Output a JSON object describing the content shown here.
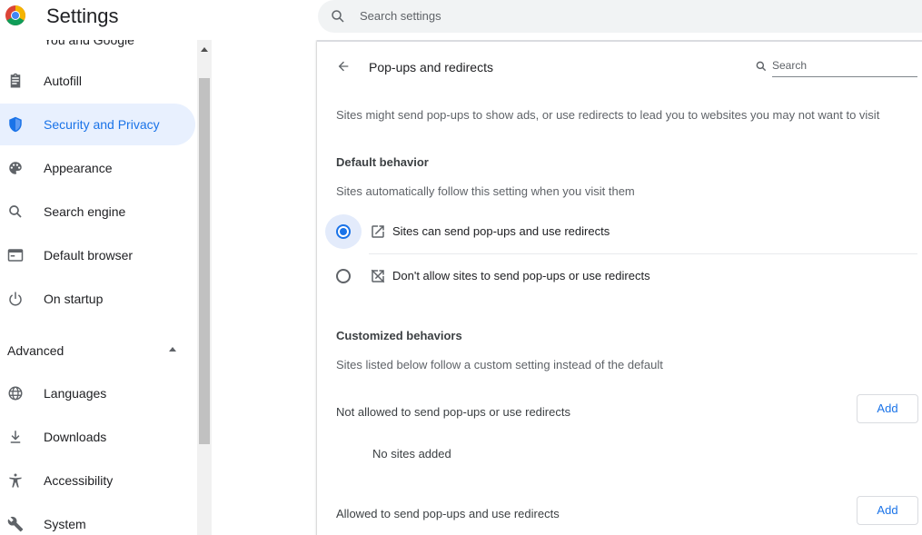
{
  "header": {
    "app_title": "Settings",
    "search_placeholder": "Search settings"
  },
  "sidebar": {
    "partial_item": "You and Google",
    "items": [
      {
        "label": "Autofill",
        "icon": "clipboard-icon"
      },
      {
        "label": "Security and Privacy",
        "icon": "shield-icon",
        "active": true
      },
      {
        "label": "Appearance",
        "icon": "palette-icon"
      },
      {
        "label": "Search engine",
        "icon": "search-icon"
      },
      {
        "label": "Default browser",
        "icon": "browser-icon"
      },
      {
        "label": "On startup",
        "icon": "power-icon"
      }
    ],
    "advanced_label": "Advanced",
    "advanced_items": [
      {
        "label": "Languages",
        "icon": "globe-icon"
      },
      {
        "label": "Downloads",
        "icon": "download-icon"
      },
      {
        "label": "Accessibility",
        "icon": "accessibility-icon"
      },
      {
        "label": "System",
        "icon": "wrench-icon"
      }
    ]
  },
  "main": {
    "title": "Pop-ups and redirects",
    "search_placeholder": "Search",
    "description": "Sites might send pop-ups to show ads, or use redirects to lead you to websites you may not want to visit",
    "default_behavior": {
      "heading": "Default behavior",
      "subtext": "Sites automatically follow this setting when you visit them",
      "options": [
        {
          "label": "Sites can send pop-ups and use redirects",
          "icon": "open-in-new-icon",
          "selected": true
        },
        {
          "label": "Don't allow sites to send pop-ups or use redirects",
          "icon": "popup-blocked-icon",
          "selected": false
        }
      ]
    },
    "customized": {
      "heading": "Customized behaviors",
      "subtext": "Sites listed below follow a custom setting instead of the default",
      "not_allowed_label": "Not allowed to send pop-ups or use redirects",
      "add_label": "Add",
      "no_sites": "No sites added",
      "allowed_label": "Allowed to send pop-ups and use redirects"
    }
  },
  "colors": {
    "accent": "#1a73e8",
    "active_bg": "#e8f0fe"
  }
}
